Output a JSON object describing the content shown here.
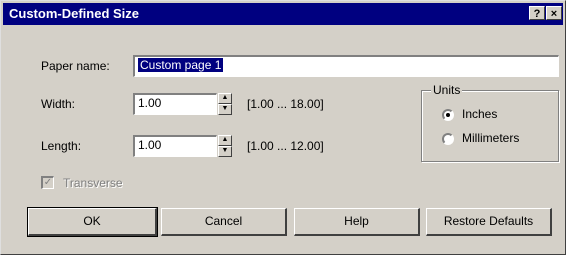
{
  "window": {
    "title": "Custom-Defined Size",
    "help_label": "?",
    "close_label": "×"
  },
  "paper_name": {
    "label": "Paper name:",
    "value": "Custom page 1"
  },
  "width": {
    "label": "Width:",
    "value": "1.00",
    "range": "[1.00 ... 18.00]"
  },
  "length": {
    "label": "Length:",
    "value": "1.00",
    "range": "[1.00 ... 12.00]"
  },
  "units": {
    "title": "Units",
    "options": [
      {
        "label": "Inches",
        "selected": true
      },
      {
        "label": "Millimeters",
        "selected": false
      }
    ]
  },
  "transverse": {
    "label": "Transverse",
    "checked": true,
    "enabled": false
  },
  "buttons": {
    "ok": "OK",
    "cancel": "Cancel",
    "help": "Help",
    "restore": "Restore Defaults"
  },
  "icons": {
    "spin_up": "spin-up-arrow",
    "spin_down": "spin-down-arrow",
    "checkmark": "check-icon"
  }
}
